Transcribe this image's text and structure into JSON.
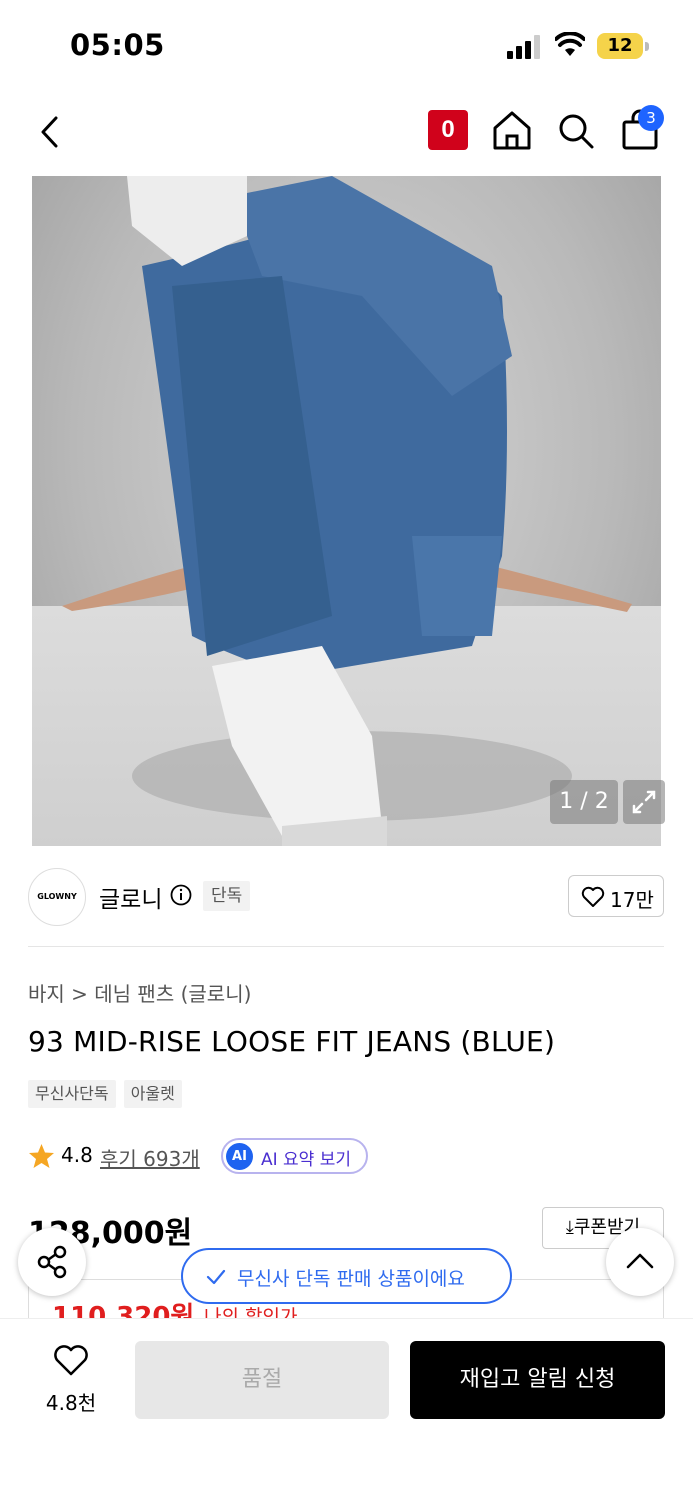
{
  "status_bar": {
    "time": "05:05",
    "battery": "12"
  },
  "nav": {
    "zero_badge": "0",
    "cart_count": "3"
  },
  "hero": {
    "pager": "1 / 2"
  },
  "brand": {
    "logo_text": "GLOWNY",
    "name": "글로니",
    "exclusive_badge": "단독",
    "like_count": "17만"
  },
  "breadcrumb": "바지 > 데님 팬츠 (글로니)",
  "product": {
    "title": "93 MID-RISE LOOSE FIT JEANS (BLUE)",
    "tags": [
      "무신사단독",
      "아울렛"
    ],
    "rating": "4.8",
    "review_link": "후기 693개",
    "ai_icon": "AI",
    "ai_label": "AI 요약 보기",
    "price": "128,000원",
    "coupon_label": "쿠폰받기",
    "discount_price": "110,320원",
    "discount_label": "나의 할인가"
  },
  "toast": {
    "text": "무신사 단독 판매 상품이에요"
  },
  "bottom_bar": {
    "wish_count": "4.8천",
    "soldout_label": "품절",
    "restock_label": "재입고 알림 신청"
  },
  "colors": {
    "accent_red": "#d0021b",
    "badge_blue": "#1e64ff",
    "ai_purple": "#4a2fd0",
    "toast_blue": "#2f6bef",
    "sale_red": "#e01e1e"
  }
}
